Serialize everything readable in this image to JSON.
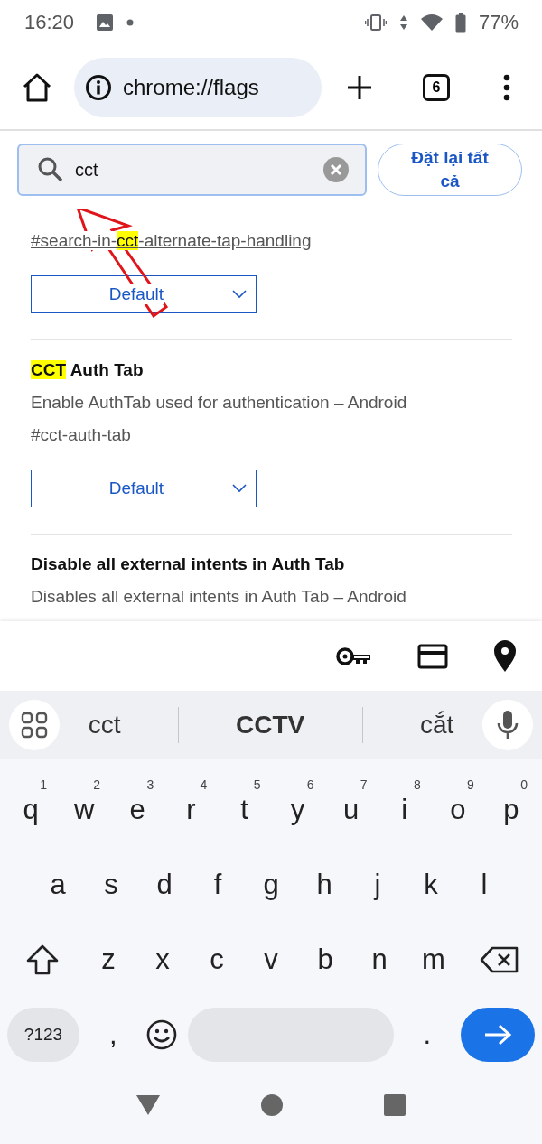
{
  "status_bar": {
    "time": "16:20",
    "battery": "77%"
  },
  "toolbar": {
    "url": "chrome://flags",
    "tab_count": "6"
  },
  "search": {
    "value": "cct",
    "reset_button": "Đặt lại tất cả"
  },
  "flags": [
    {
      "link": [
        {
          "text": "#search-in-",
          "highlight": false
        },
        {
          "text": "cct",
          "highlight": true
        },
        {
          "text": "-alternate-tap-handling",
          "highlight": false
        }
      ],
      "select": "Default"
    },
    {
      "title": [
        {
          "text": "CCT",
          "highlight": true
        },
        {
          "text": " Auth Tab",
          "highlight": false
        }
      ],
      "description": "Enable AuthTab used for authentication – Android",
      "link": [
        {
          "text": "#cct-auth-tab",
          "highlight": false
        }
      ],
      "select": "Default"
    },
    {
      "title": [
        {
          "text": "Disable all external intents in Auth Tab",
          "highlight": false
        }
      ],
      "description": "Disables all external intents in Auth Tab – Android"
    }
  ],
  "suggestions": [
    {
      "text": "cct",
      "primary": false
    },
    {
      "text": "CCTV",
      "primary": true
    },
    {
      "text": "cắt",
      "primary": false
    }
  ],
  "keyboard": [
    [
      {
        "kind": "letter",
        "label": "q",
        "hint": "1"
      },
      {
        "kind": "letter",
        "label": "w",
        "hint": "2"
      },
      {
        "kind": "letter",
        "label": "e",
        "hint": "3"
      },
      {
        "kind": "letter",
        "label": "r",
        "hint": "4"
      },
      {
        "kind": "letter",
        "label": "t",
        "hint": "5"
      },
      {
        "kind": "letter",
        "label": "y",
        "hint": "6"
      },
      {
        "kind": "letter",
        "label": "u",
        "hint": "7"
      },
      {
        "kind": "letter",
        "label": "i",
        "hint": "8"
      },
      {
        "kind": "letter",
        "label": "o",
        "hint": "9"
      },
      {
        "kind": "letter",
        "label": "p",
        "hint": "0"
      }
    ],
    [
      {
        "kind": "letter",
        "label": "a"
      },
      {
        "kind": "letter",
        "label": "s"
      },
      {
        "kind": "letter",
        "label": "d"
      },
      {
        "kind": "letter",
        "label": "f"
      },
      {
        "kind": "letter",
        "label": "g"
      },
      {
        "kind": "letter",
        "label": "h"
      },
      {
        "kind": "letter",
        "label": "j"
      },
      {
        "kind": "letter",
        "label": "k"
      },
      {
        "kind": "letter",
        "label": "l"
      }
    ],
    [
      {
        "kind": "shift"
      },
      {
        "kind": "letter",
        "label": "z"
      },
      {
        "kind": "letter",
        "label": "x"
      },
      {
        "kind": "letter",
        "label": "c"
      },
      {
        "kind": "letter",
        "label": "v"
      },
      {
        "kind": "letter",
        "label": "b"
      },
      {
        "kind": "letter",
        "label": "n"
      },
      {
        "kind": "letter",
        "label": "m"
      },
      {
        "kind": "backspace"
      }
    ],
    [
      {
        "kind": "symbols",
        "label": "?123"
      },
      {
        "kind": "letter",
        "label": ","
      },
      {
        "kind": "emoji"
      },
      {
        "kind": "space"
      },
      {
        "kind": "letter",
        "label": "."
      },
      {
        "kind": "enter"
      }
    ]
  ]
}
